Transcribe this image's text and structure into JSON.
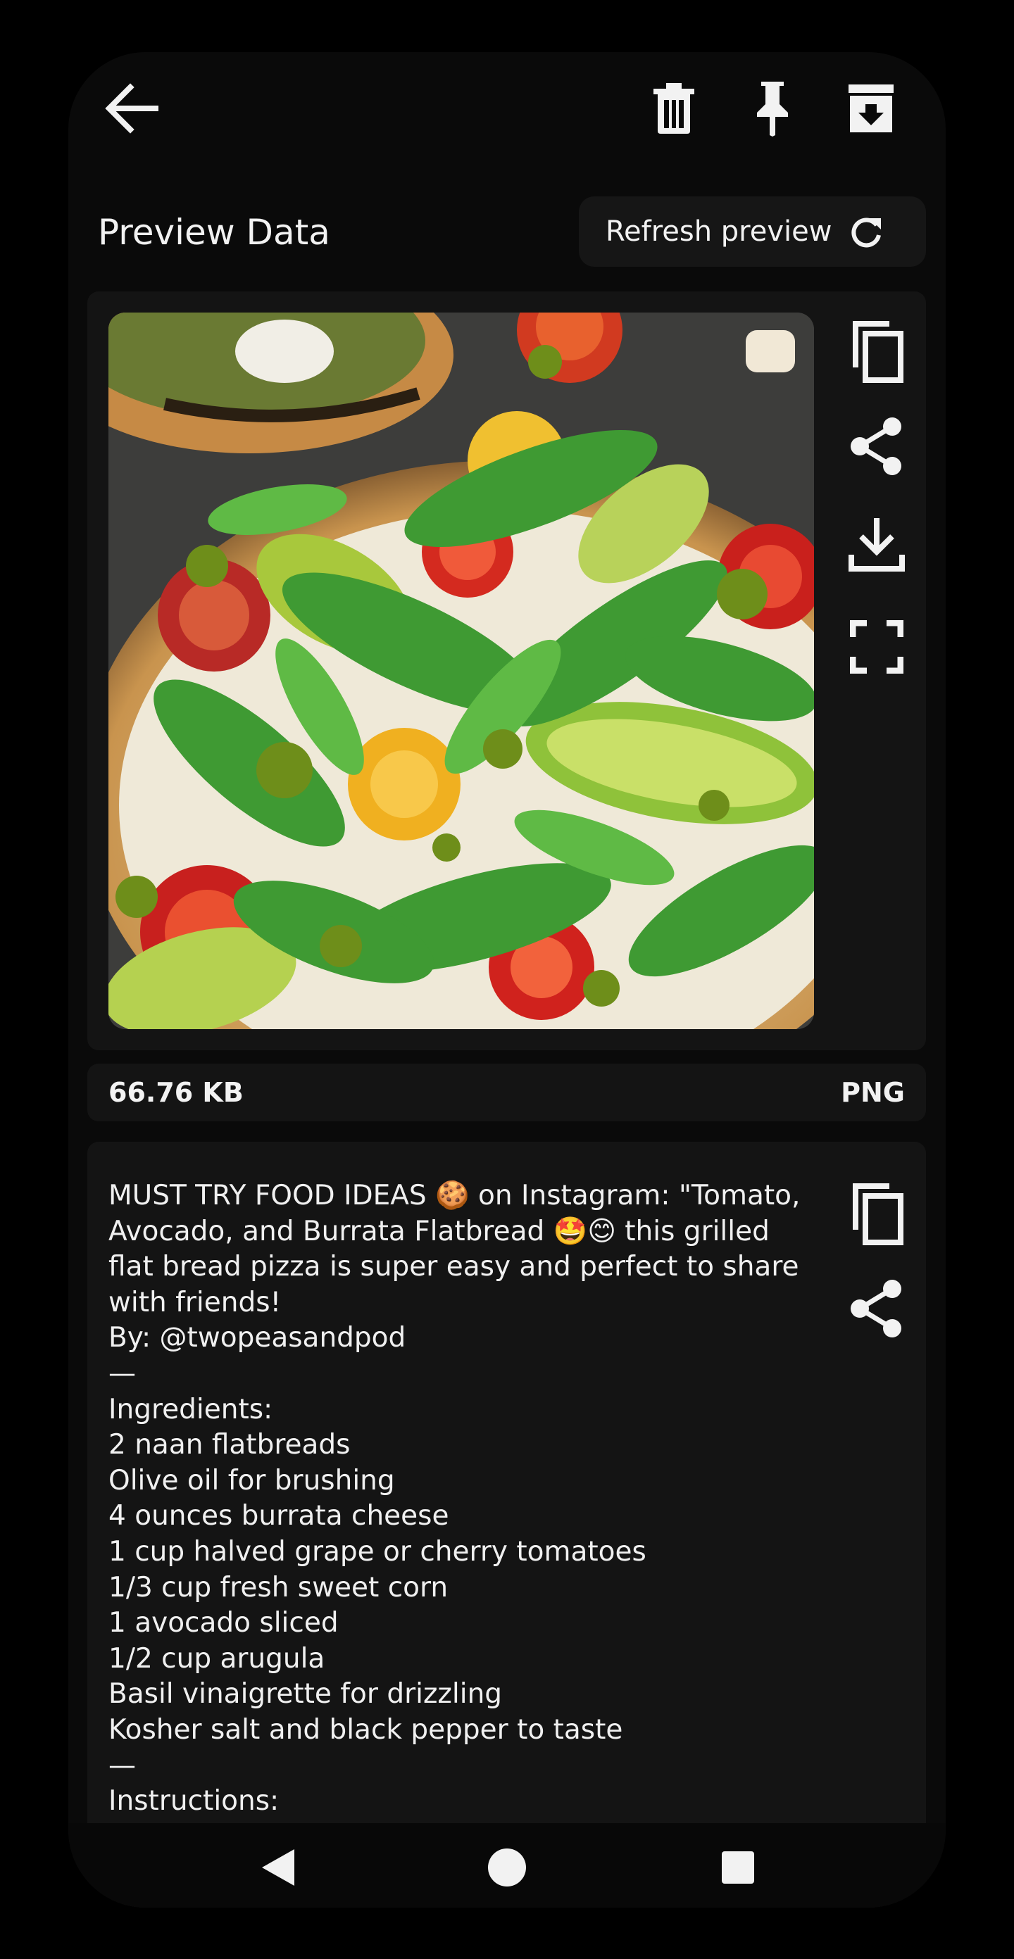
{
  "colors": {
    "background": "#000000",
    "surface": "#141414",
    "text": "#f2f2f2"
  },
  "toolbar": {
    "back_icon": "arrow-left-icon",
    "delete_icon": "trash-icon",
    "pin_icon": "pin-icon",
    "archive_icon": "archive-icon"
  },
  "preview": {
    "title": "Preview Data",
    "refresh_label": "Refresh preview",
    "refresh_icon": "refresh-icon",
    "image_alt": "Grilled flatbread pizza with avocado, tomatoes, arugula and pesto"
  },
  "image_actions": [
    "copy-icon",
    "share-icon",
    "download-icon",
    "fullscreen-icon"
  ],
  "meta": {
    "size": "66.76 KB",
    "format": "PNG"
  },
  "text_actions": [
    "copy-icon",
    "share-icon"
  ],
  "description": {
    "text": "MUST TRY FOOD IDEAS 🍪 on Instagram: \"Tomato, Avocado, and Burrata Flatbread 🤩😊 this grilled flat bread pizza is super easy and perfect to share with friends!\nBy: @twopeasandpod\n—\nIngredients:\n2 naan flatbreads\nOlive oil for brushing\n4 ounces burrata cheese\n1 cup halved grape or cherry tomatoes\n1/3 cup fresh sweet corn\n1 avocado sliced\n1/2 cup arugula\nBasil vinaigrette for drizzling\nKosher salt and black pepper to taste\n—\nInstructions:"
  },
  "system_nav": {
    "back_icon": "nav-back-icon",
    "home_icon": "nav-home-icon",
    "recents_icon": "nav-recents-icon"
  }
}
